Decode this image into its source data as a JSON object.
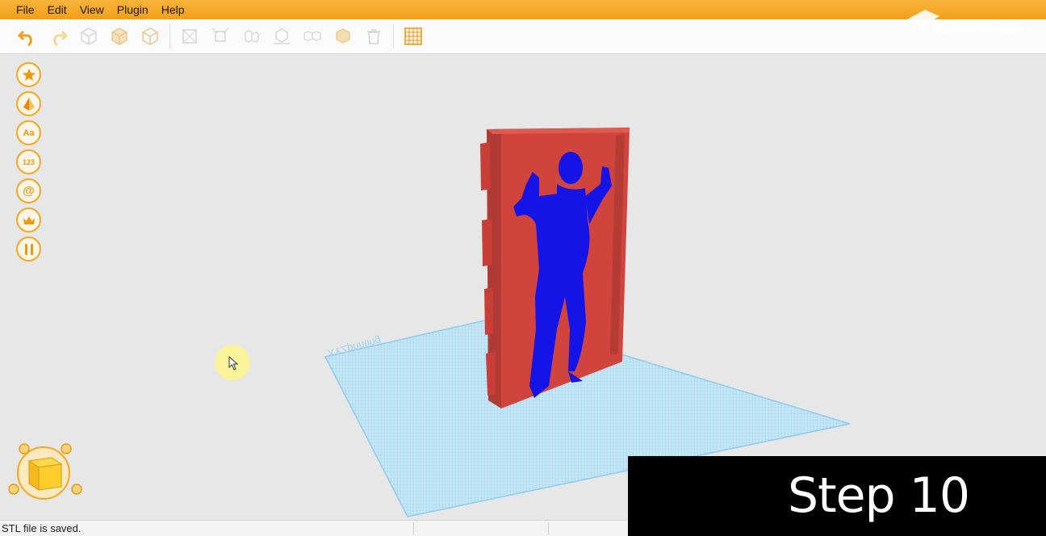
{
  "menu": {
    "items": [
      "File",
      "Edit",
      "View",
      "Plugin",
      "Help"
    ]
  },
  "toolbar": {
    "buttons": [
      "undo-icon",
      "redo-icon",
      "cube-outline-icon",
      "cube-split-icon",
      "cube-stack-icon",
      "transform-icon",
      "scale-icon",
      "align-icon",
      "drop-to-bed-icon",
      "group-icon",
      "ungroup-icon",
      "trash-icon",
      "grid-icon"
    ]
  },
  "sidetools": {
    "items": [
      {
        "name": "favorites-tool",
        "icon": "star-icon",
        "label": ""
      },
      {
        "name": "shape-tool",
        "icon": "pyramid-icon",
        "label": ""
      },
      {
        "name": "text-tool",
        "icon": "text-icon",
        "label": "Aa"
      },
      {
        "name": "number-tool",
        "icon": "number-icon",
        "label": "123"
      },
      {
        "name": "symbol-tool",
        "icon": "at-icon",
        "label": "@"
      },
      {
        "name": "crown-tool",
        "icon": "crown-icon",
        "label": ""
      },
      {
        "name": "kitchen-tool",
        "icon": "utensils-icon",
        "label": ""
      }
    ]
  },
  "viewport": {
    "platform_label": "XYZprinting"
  },
  "status": {
    "message": "STL file is saved."
  },
  "overlay": {
    "step_text": "Step 10"
  },
  "colors": {
    "accent": "#f29f1a",
    "model_red": "#d9534a",
    "model_blue": "#1a1ee8",
    "grid_blue": "#a9d8f0"
  }
}
